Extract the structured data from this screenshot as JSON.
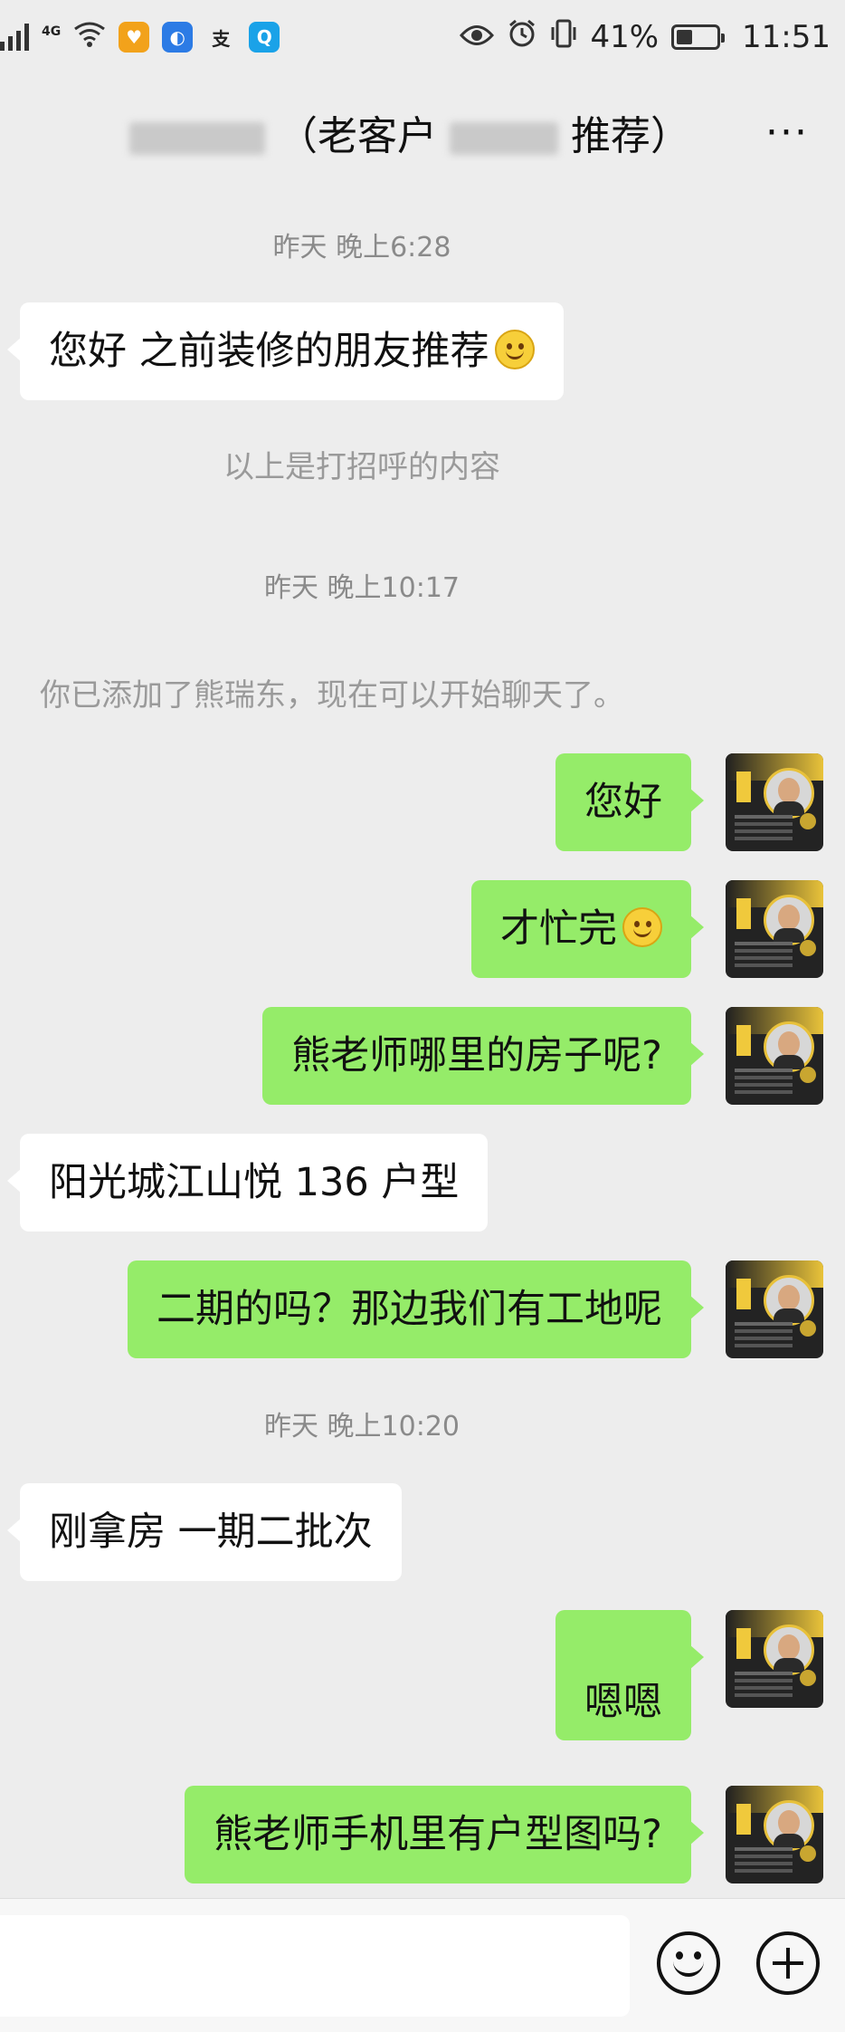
{
  "status_bar": {
    "network": "4G",
    "app_badge_1": "♥",
    "app_badge_2": "◐",
    "app_badge_3": "支",
    "app_badge_4": "Q",
    "battery": "41%",
    "time": "11:51"
  },
  "header": {
    "title_part_1": "（老客户",
    "title_part_2": "推荐）",
    "more_label": "···"
  },
  "messages": [
    {
      "type": "time",
      "text": "昨天 晚上6:28"
    },
    {
      "type": "in",
      "text": "您好 之前装修的朋友推荐",
      "emoji": "smile"
    },
    {
      "type": "system",
      "text": "以上是打招呼的内容"
    },
    {
      "type": "time",
      "text": "昨天 晚上10:17"
    },
    {
      "type": "system",
      "text": "你已添加了熊瑞东，现在可以开始聊天了。"
    },
    {
      "type": "out",
      "text": "您好"
    },
    {
      "type": "out",
      "text": "才忙完",
      "emoji": "smile"
    },
    {
      "type": "out",
      "text": "熊老师哪里的房子呢?"
    },
    {
      "type": "in",
      "text": "阳光城江山悦 136 户型"
    },
    {
      "type": "out",
      "text": "二期的吗？那边我们有工地呢"
    },
    {
      "type": "time",
      "text": "昨天 晚上10:20"
    },
    {
      "type": "in",
      "text": "刚拿房 一期二批次"
    },
    {
      "type": "out",
      "text": "嗯嗯"
    },
    {
      "type": "out",
      "text": "熊老师手机里有户型图吗?"
    }
  ],
  "input": {
    "placeholder": ""
  },
  "colors": {
    "background": "#ededed",
    "outgoing_bubble": "#95ec69",
    "incoming_bubble": "#ffffff"
  },
  "icons": {
    "emoji": "smile-icon",
    "add": "plus-circle-icon"
  }
}
